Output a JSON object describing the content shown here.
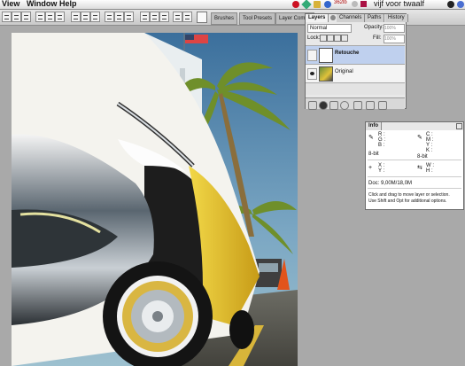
{
  "menu": {
    "view": "View",
    "window": "Window",
    "help": "Help"
  },
  "status": {
    "clock": "vijf voor twaalf",
    "memory": "362lb"
  },
  "toolbar": {
    "tabs": [
      "Brushes",
      "Tool Presets",
      "Layer Comps"
    ],
    "layers_tab": "Layers",
    "channels_tab": "Channels",
    "paths_tab": "Paths",
    "history_tab": "History"
  },
  "layers_panel": {
    "blend_mode": "Normal",
    "opacity_label": "Opacity:",
    "opacity_value": "100%",
    "lock_label": "Lock:",
    "fill_label": "Fill:",
    "fill_value": "100%",
    "layers": [
      {
        "name": "Retouche"
      },
      {
        "name": "Original"
      }
    ]
  },
  "info_panel": {
    "tab": "Info",
    "r": "R :",
    "g": "G :",
    "b": "B :",
    "c": "C :",
    "m": "M :",
    "y": "Y :",
    "k": "K :",
    "bit1": "8-bit",
    "bit2": "8-bit",
    "x": "X :",
    "yy": "Y :",
    "w": "W :",
    "h": "H :",
    "doc": "Doc: 9,00M/18,0M",
    "hint1": "Click and drag to move layer or selection.",
    "hint2": "Use Shift and Opt for additional options."
  },
  "colors": {
    "accent": "#3a6fcf",
    "car_yellow": "#e3c02a",
    "sky": "#7ba7c3"
  }
}
